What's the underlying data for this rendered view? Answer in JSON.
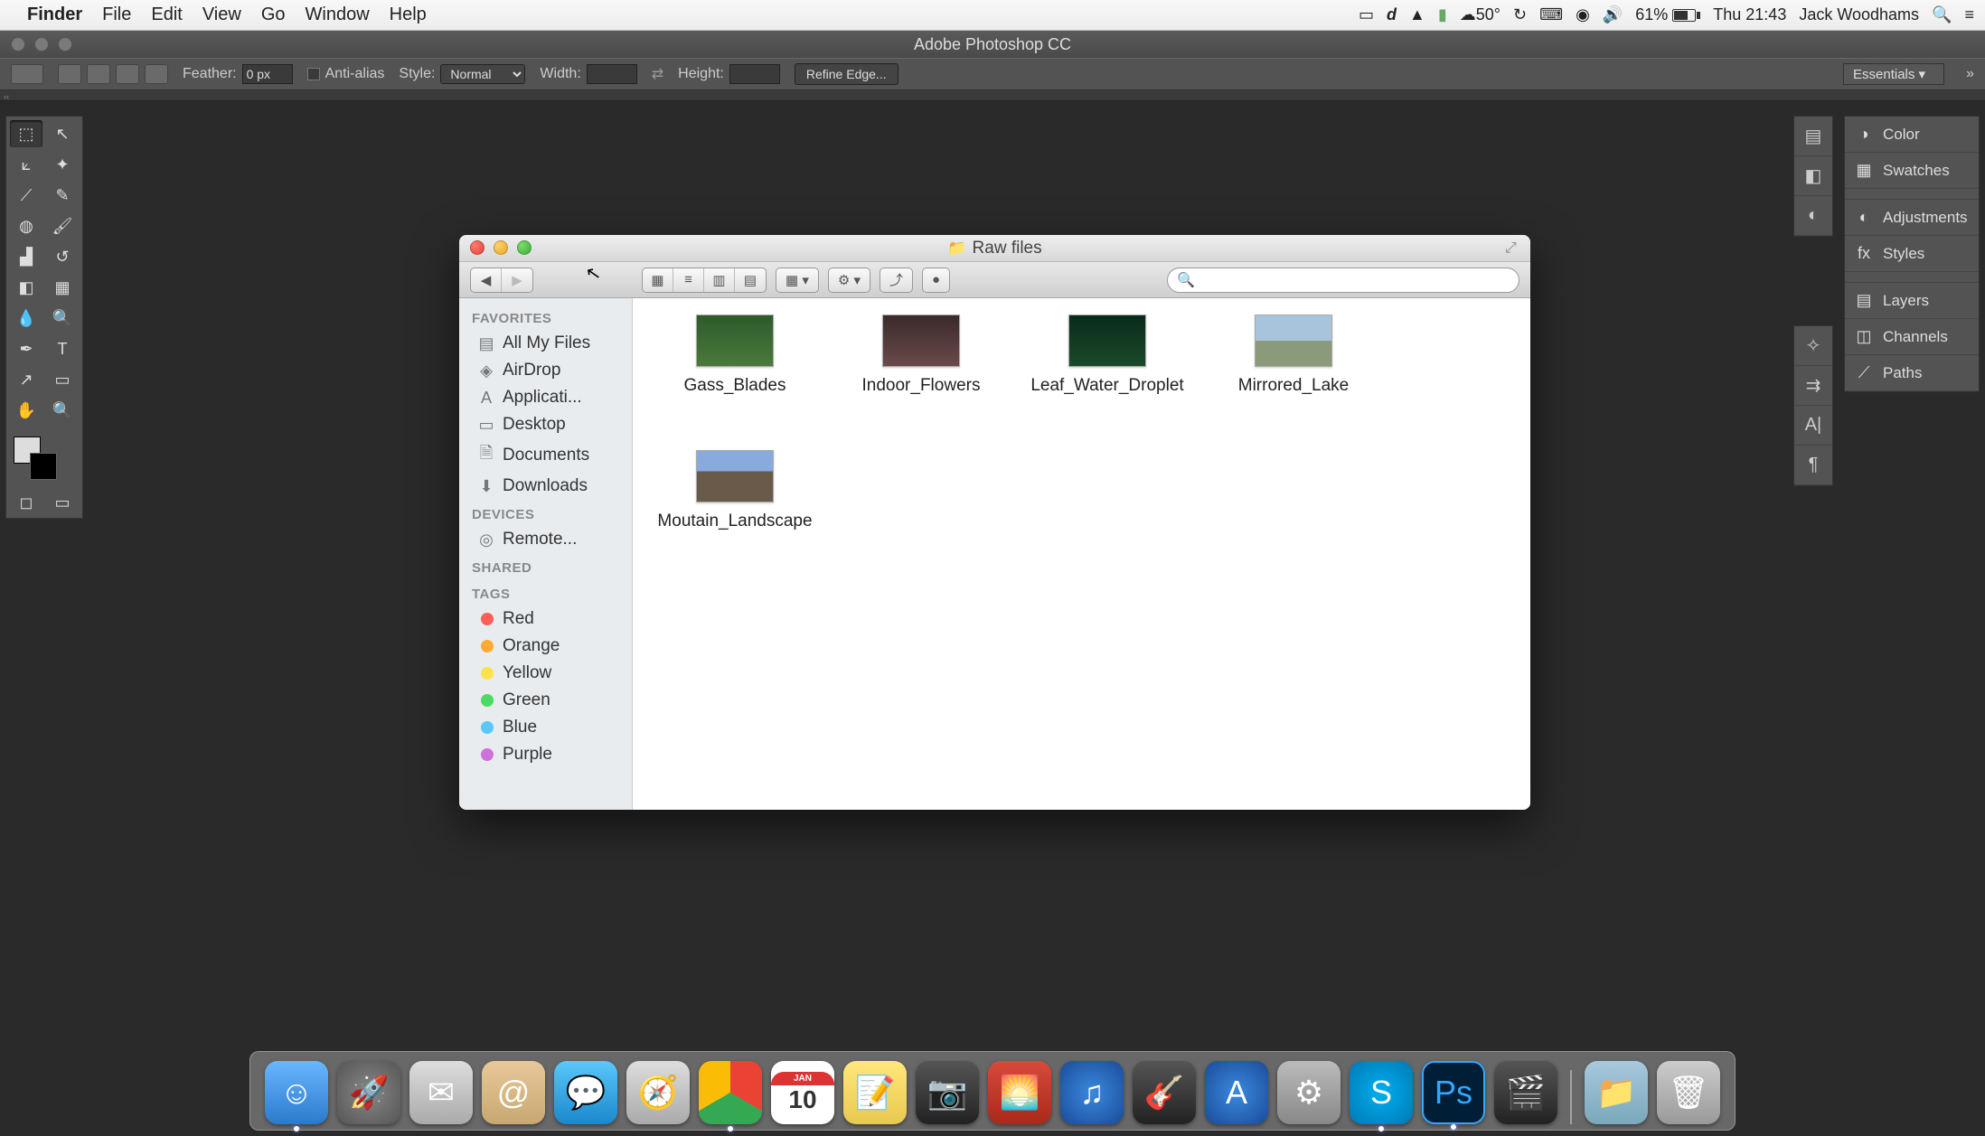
{
  "menubar": {
    "app_name": "Finder",
    "items": [
      "File",
      "Edit",
      "View",
      "Go",
      "Window",
      "Help"
    ],
    "temp": "50°",
    "battery_pct": "61%",
    "datetime": "Thu 21:43",
    "user": "Jack Woodhams"
  },
  "photoshop": {
    "title": "Adobe Photoshop CC",
    "options": {
      "feather_label": "Feather:",
      "feather_value": "0 px",
      "antialias_label": "Anti-alias",
      "style_label": "Style:",
      "style_value": "Normal",
      "width_label": "Width:",
      "height_label": "Height:",
      "refine_label": "Refine Edge...",
      "workspace": "Essentials"
    },
    "right_panels_a": [
      "Color",
      "Swatches"
    ],
    "right_panels_b": [
      "Adjustments",
      "Styles"
    ],
    "right_panels_c": [
      "Layers",
      "Channels",
      "Paths"
    ]
  },
  "finder": {
    "title": "Raw files",
    "sidebar": {
      "favorites_hdr": "FAVORITES",
      "favorites": [
        {
          "icon": "▤",
          "label": "All My Files"
        },
        {
          "icon": "◈",
          "label": "AirDrop"
        },
        {
          "icon": "A",
          "label": "Applicati..."
        },
        {
          "icon": "▭",
          "label": "Desktop"
        },
        {
          "icon": "🗎",
          "label": "Documents"
        },
        {
          "icon": "⬇",
          "label": "Downloads"
        }
      ],
      "devices_hdr": "DEVICES",
      "devices": [
        {
          "icon": "◎",
          "label": "Remote..."
        }
      ],
      "shared_hdr": "SHARED",
      "tags_hdr": "TAGS",
      "tags": [
        {
          "color": "#ff5f57",
          "label": "Red"
        },
        {
          "color": "#ffaa33",
          "label": "Orange"
        },
        {
          "color": "#ffe14d",
          "label": "Yellow"
        },
        {
          "color": "#4cd964",
          "label": "Green"
        },
        {
          "color": "#5ac8fa",
          "label": "Blue"
        },
        {
          "color": "#d070dd",
          "label": "Purple"
        }
      ]
    },
    "files": [
      {
        "name": "Gass_Blades",
        "bg": "linear-gradient(#2d5a2d,#4a7a3a)"
      },
      {
        "name": "Indoor_Flowers",
        "bg": "linear-gradient(#3a2a2a,#6a4a4a)"
      },
      {
        "name": "Leaf_Water_Droplet",
        "bg": "linear-gradient(#0a2a1a,#1a4a2a)"
      },
      {
        "name": "Mirrored_Lake",
        "bg": "linear-gradient(#a8c4dd 50%,#8a9a7a 50%)"
      },
      {
        "name": "Moutain_Landscape",
        "bg": "linear-gradient(#88aadd 40%,#6a5a4a 40%)"
      }
    ],
    "search_placeholder": ""
  },
  "dock": {
    "apps": [
      {
        "name": "finder",
        "bg": "linear-gradient(#6ab7ff,#2a7acc)",
        "glyph": "☺",
        "active": true
      },
      {
        "name": "launchpad",
        "bg": "radial-gradient(circle,#888,#555)",
        "glyph": "🚀"
      },
      {
        "name": "mail",
        "bg": "linear-gradient(#ddd,#aaa)",
        "glyph": "✉"
      },
      {
        "name": "contacts",
        "bg": "linear-gradient(#e8c89a,#c8a870)",
        "glyph": "@"
      },
      {
        "name": "messages",
        "bg": "linear-gradient(#5ac8fa,#1a88cc)",
        "glyph": "💬"
      },
      {
        "name": "safari",
        "bg": "linear-gradient(#ddd,#aaa)",
        "glyph": "🧭"
      },
      {
        "name": "chrome",
        "bg": "conic-gradient(#ea4335 0 120deg,#34a853 120deg 240deg,#fbbc05 240deg)",
        "glyph": "",
        "active": true
      },
      {
        "name": "calendar",
        "bg": "#fff",
        "glyph": "10",
        "text": "#d33"
      },
      {
        "name": "notes",
        "bg": "linear-gradient(#ffe87a,#e8c850)",
        "glyph": "📝"
      },
      {
        "name": "photobooth",
        "bg": "linear-gradient(#555,#222)",
        "glyph": "📷"
      },
      {
        "name": "iphoto",
        "bg": "linear-gradient(#d84a3a,#a82a1a)",
        "glyph": "🌅"
      },
      {
        "name": "itunes",
        "bg": "radial-gradient(circle,#3a8add,#1a4a99)",
        "glyph": "♫"
      },
      {
        "name": "garageband",
        "bg": "linear-gradient(#555,#222)",
        "glyph": "🎸"
      },
      {
        "name": "appstore",
        "bg": "radial-gradient(circle,#3a8add,#1a4a99)",
        "glyph": "A"
      },
      {
        "name": "settings",
        "bg": "linear-gradient(#bbb,#888)",
        "glyph": "⚙"
      },
      {
        "name": "skype",
        "bg": "radial-gradient(circle,#00aff0,#0078b4)",
        "glyph": "S",
        "active": true
      },
      {
        "name": "photoshop",
        "bg": "#001e36",
        "glyph": "Ps",
        "text": "#31a8ff",
        "active": true,
        "border": "2px solid #31a8ff"
      },
      {
        "name": "imovie",
        "bg": "linear-gradient(#555,#222)",
        "glyph": "🎬"
      }
    ],
    "right": [
      {
        "name": "downloads",
        "bg": "linear-gradient(#a8c8dd,#7aa8bb)",
        "glyph": "📁"
      },
      {
        "name": "trash",
        "bg": "linear-gradient(#ccc,#999)",
        "glyph": "🗑"
      }
    ]
  }
}
